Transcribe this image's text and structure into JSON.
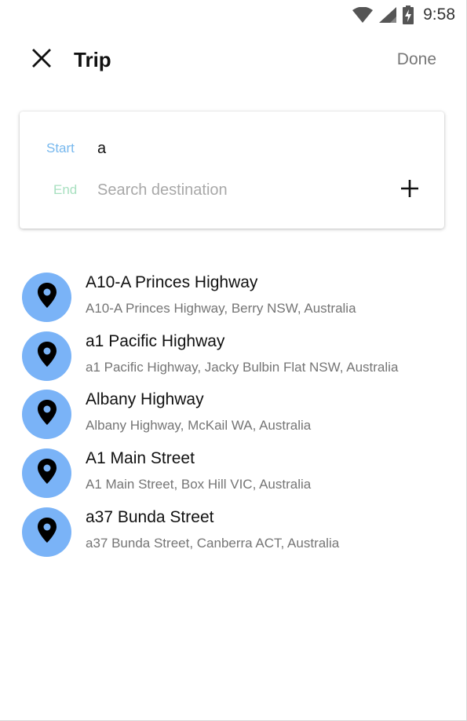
{
  "status_bar": {
    "time": "9:58",
    "icons": [
      "wifi-icon",
      "signal-icon",
      "battery-charging-icon"
    ]
  },
  "app_bar": {
    "close_icon": "close-icon",
    "title": "Trip",
    "done_label": "Done"
  },
  "trip_card": {
    "start_label": "Start",
    "start_value": "a",
    "end_label": "End",
    "end_value": "",
    "end_placeholder": "Search destination",
    "add_icon": "plus-icon"
  },
  "results": [
    {
      "title": "A10-A Princes Highway",
      "subtitle": "A10-A Princes Highway, Berry NSW, Australia"
    },
    {
      "title": "a1 Pacific Highway",
      "subtitle": "a1 Pacific Highway, Jacky Bulbin Flat NSW, Australia"
    },
    {
      "title": "Albany Highway",
      "subtitle": "Albany Highway, McKail WA, Australia"
    },
    {
      "title": "A1 Main Street",
      "subtitle": "A1 Main Street, Box Hill VIC, Australia"
    },
    {
      "title": "a37 Bunda Street",
      "subtitle": "a37 Bunda Street, Canberra ACT, Australia"
    }
  ],
  "colors": {
    "pin_circle": "#7ab3f7",
    "start_label": "#77b8ee",
    "end_label": "#a8e0c0"
  }
}
